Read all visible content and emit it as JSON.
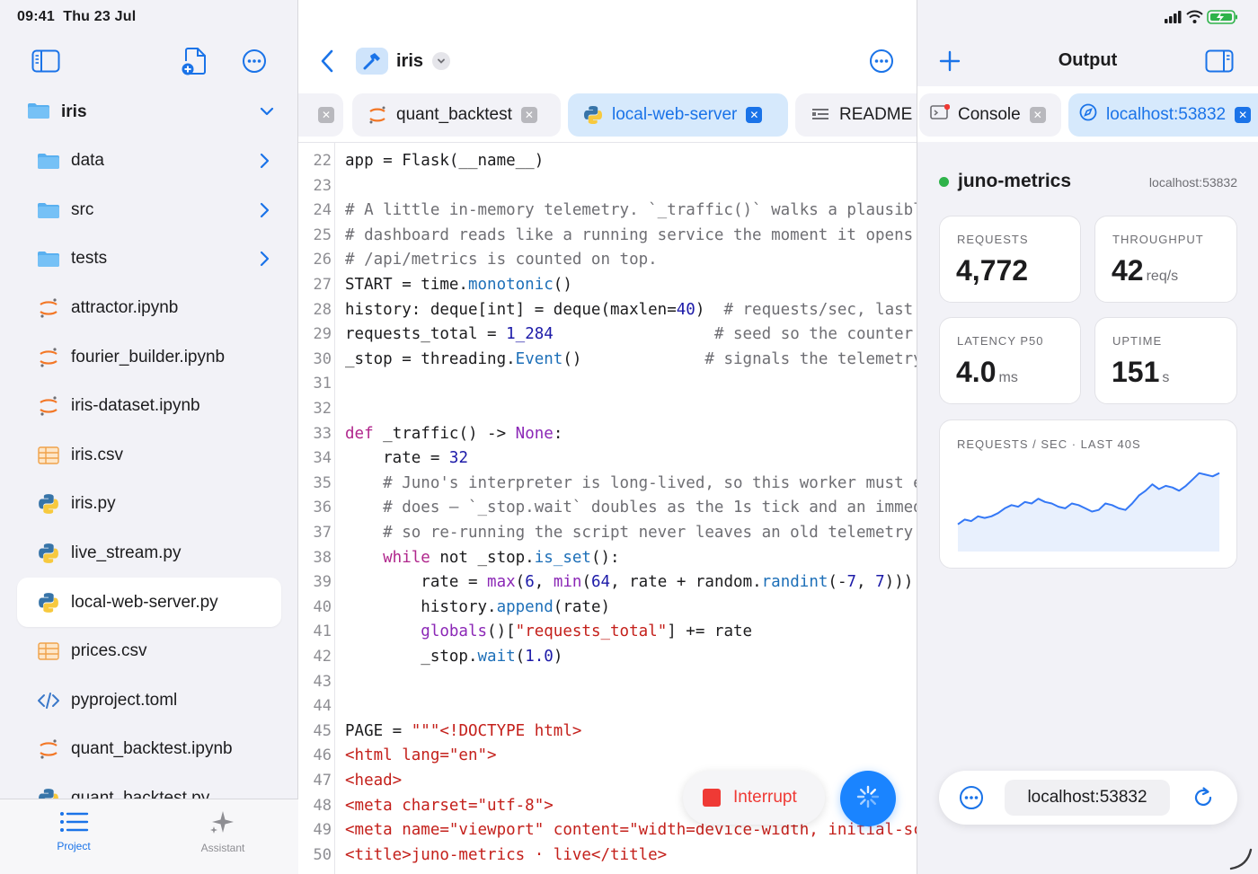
{
  "status": {
    "time": "09:41",
    "date": "Thu 23 Jul"
  },
  "sidebar": {
    "project_name": "iris",
    "items": [
      {
        "name": "data",
        "type": "folder"
      },
      {
        "name": "src",
        "type": "folder"
      },
      {
        "name": "tests",
        "type": "folder"
      },
      {
        "name": "attractor.ipynb",
        "type": "notebook"
      },
      {
        "name": "fourier_builder.ipynb",
        "type": "notebook"
      },
      {
        "name": "iris-dataset.ipynb",
        "type": "notebook"
      },
      {
        "name": "iris.csv",
        "type": "csv"
      },
      {
        "name": "iris.py",
        "type": "python"
      },
      {
        "name": "live_stream.py",
        "type": "python"
      },
      {
        "name": "local-web-server.py",
        "type": "python",
        "selected": true
      },
      {
        "name": "prices.csv",
        "type": "csv"
      },
      {
        "name": "pyproject.toml",
        "type": "toml"
      },
      {
        "name": "quant_backtest.ipynb",
        "type": "notebook"
      },
      {
        "name": "quant_backtest.py",
        "type": "python"
      }
    ],
    "bottom_tabs": {
      "project": "Project",
      "assistant": "Assistant"
    }
  },
  "editor": {
    "title": "iris",
    "tabs": [
      {
        "label": "quant_backtest",
        "icon": "notebook-icon"
      },
      {
        "label": "local-web-server",
        "icon": "python-icon",
        "active": true
      },
      {
        "label": "README",
        "icon": "markdown-icon"
      }
    ],
    "line_numbers": [
      "22",
      "23",
      "24",
      "25",
      "26",
      "27",
      "28",
      "29",
      "30",
      "31",
      "32",
      "33",
      "34",
      "35",
      "36",
      "37",
      "38",
      "39",
      "40",
      "41",
      "42",
      "43",
      "44",
      "45",
      "46",
      "47",
      "48",
      "49",
      "50"
    ],
    "interrupt_label": "Interrupt"
  },
  "output": {
    "title": "Output",
    "tabs": [
      {
        "label": "Console"
      },
      {
        "label": "localhost:53832",
        "active": true
      }
    ],
    "app_name": "juno-metrics",
    "host": "localhost:53832",
    "metrics": {
      "requests": {
        "label": "REQUESTS",
        "value": "4,772"
      },
      "throughput": {
        "label": "THROUGHPUT",
        "value": "42",
        "unit": "req/s"
      },
      "latency": {
        "label": "LATENCY P50",
        "value": "4.0",
        "unit": "ms"
      },
      "uptime": {
        "label": "UPTIME",
        "value": "151",
        "unit": "s"
      }
    },
    "chart_label": "REQUESTS / SEC · LAST 40S",
    "url": "localhost:53832"
  },
  "chart_data": {
    "type": "area",
    "title": "REQUESTS / SEC · LAST 40S",
    "values": [
      17,
      20,
      19,
      22,
      21,
      22,
      24,
      27,
      29,
      28,
      31,
      30,
      33,
      31,
      30,
      28,
      27,
      30,
      29,
      27,
      25,
      26,
      30,
      29,
      27,
      26,
      30,
      35,
      38,
      42,
      39,
      41,
      40,
      38,
      41,
      45,
      49,
      48,
      47,
      49
    ],
    "color": "#3478f6",
    "fill": "#e8f0fd"
  }
}
